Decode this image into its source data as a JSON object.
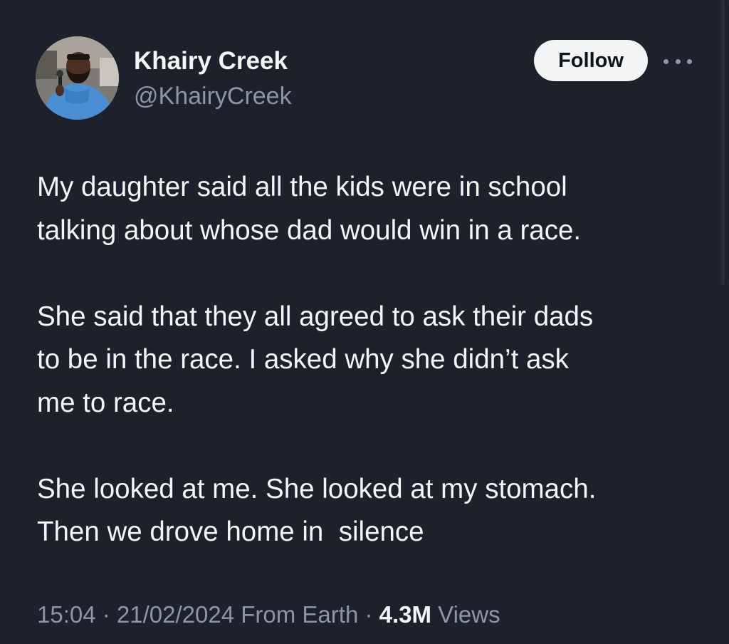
{
  "author": {
    "name": "Khairy Creek",
    "handle": "@KhairyCreek",
    "avatar_icon": "profile-photo"
  },
  "actions": {
    "follow_label": "Follow",
    "more_icon": "ellipsis-icon"
  },
  "tweet": {
    "lines": [
      "My daughter said all the kids were in school\ntalking about whose dad would win in a race.",
      "She said that they all agreed to ask their dads\nto be in the race. I asked why she didn’t ask\nme to race.",
      "She looked at me. She looked at my stomach.\nThen we drove home in  silence"
    ]
  },
  "meta": {
    "time": "15:04",
    "separator1": " · ",
    "date": "21/02/2024",
    "source": " From Earth",
    "separator2": " · ",
    "views_count": "4.3M",
    "views_label": " Views"
  },
  "colors": {
    "background": "#1c212b",
    "primary_text": "#f3f5f7",
    "secondary_text": "#8d96a3",
    "follow_bg": "#f3f4f5"
  }
}
